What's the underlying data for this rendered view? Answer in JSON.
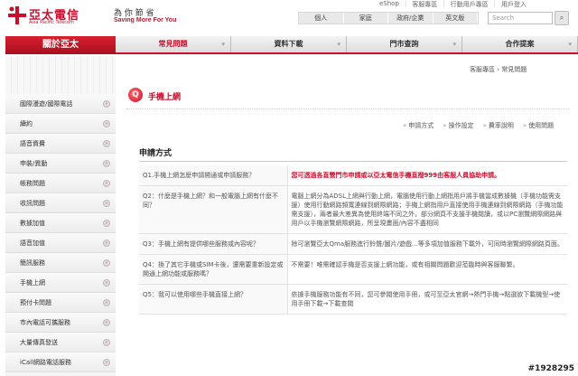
{
  "brand": {
    "name": "亞太電信",
    "sub": "Asia Pacific Telecom",
    "slogan_cn": "為 你 節 省",
    "slogan_en": "Saving More For You"
  },
  "toplinks": [
    "eShop",
    "客服專區",
    "行動用戶專區",
    "用戶登入"
  ],
  "segments": [
    "個人",
    "家庭",
    "政府/企業",
    "英文版"
  ],
  "search": {
    "placeholder": "Search",
    "icon": "search-icon"
  },
  "side_banner": "關於亞太",
  "mainnav": [
    {
      "label": "常見問題",
      "active": true
    },
    {
      "label": "資料下載",
      "active": false
    },
    {
      "label": "門市查詢",
      "active": false
    },
    {
      "label": "合作提案",
      "active": false
    }
  ],
  "sidebar": [
    "國際漫遊/國際電話",
    "續約",
    "語音資費",
    "申裝/異動",
    "帳務問題",
    "收訊問題",
    "數據加值",
    "語音加值",
    "簡訊服務",
    "手機上網",
    "預付卡問題",
    "市內電話可攜服務",
    "大量傳真發送",
    "iCall網路電話服務"
  ],
  "breadcrumb": "客服專區 › 常見問題",
  "page_title": "手機上網",
  "subtabs": [
    "申請方式",
    "操作設定",
    "費率說明",
    "使用問題"
  ],
  "section_title": "申請方式",
  "faq": [
    {
      "q": "Q1.手機上網怎麼申請開通或申請服務？",
      "a": "您可透過各直營門市申請或以亞太電信手機直撥999由客服人員協助申請。",
      "highlight": true
    },
    {
      "q": "Q2：什麼是手機上網？和一般電腦上網有什麼不同？",
      "a": "電腦上網分為ADSL上網與行動上網，電腦使用行動上網指用戶將手機當成數據機（手機功能需支援）使用行動網路頻寬連線到網際網路；手機上網指用戶直接使用手機連線到網際網路（手機功能需支援），兩者最大差異為使用終端不同之外，部分網頁不支援手機閱讀，或以PC瀏覽網際網路與用戶以手機瀏覽網際網路，所呈現畫面/內容不盡相同",
      "highlight": false
    },
    {
      "q": "Q3：手機上網有提供哪些服務或內容呢？",
      "a": "除可瀏覽亞太Qma服務進行鈴聲/圖片/遊戲…等多項加值服務下載外，可同時瀏覽網際網路頁面。",
      "highlight": false
    },
    {
      "q": "Q4：換了其它手機或SIM卡後，還需要重新設定或開通上網功能或服務嗎？",
      "a": "不需要！唯需確認手機是否支援上網功能，或有相關問題歡迎蒞臨時與客服聯繫。",
      "highlight": false
    },
    {
      "q": "Q5：我可以使用哪些手機直接上網？",
      "a": "依據手機服務功能有不同，您可參閱使用手冊，或可至亞太官網→熱門手機→點選欲下載機型→使用手冊下載→下載查閱",
      "highlight": false
    }
  ],
  "watermark": "#1928295",
  "colors": {
    "brand_red": "#c8102e"
  }
}
